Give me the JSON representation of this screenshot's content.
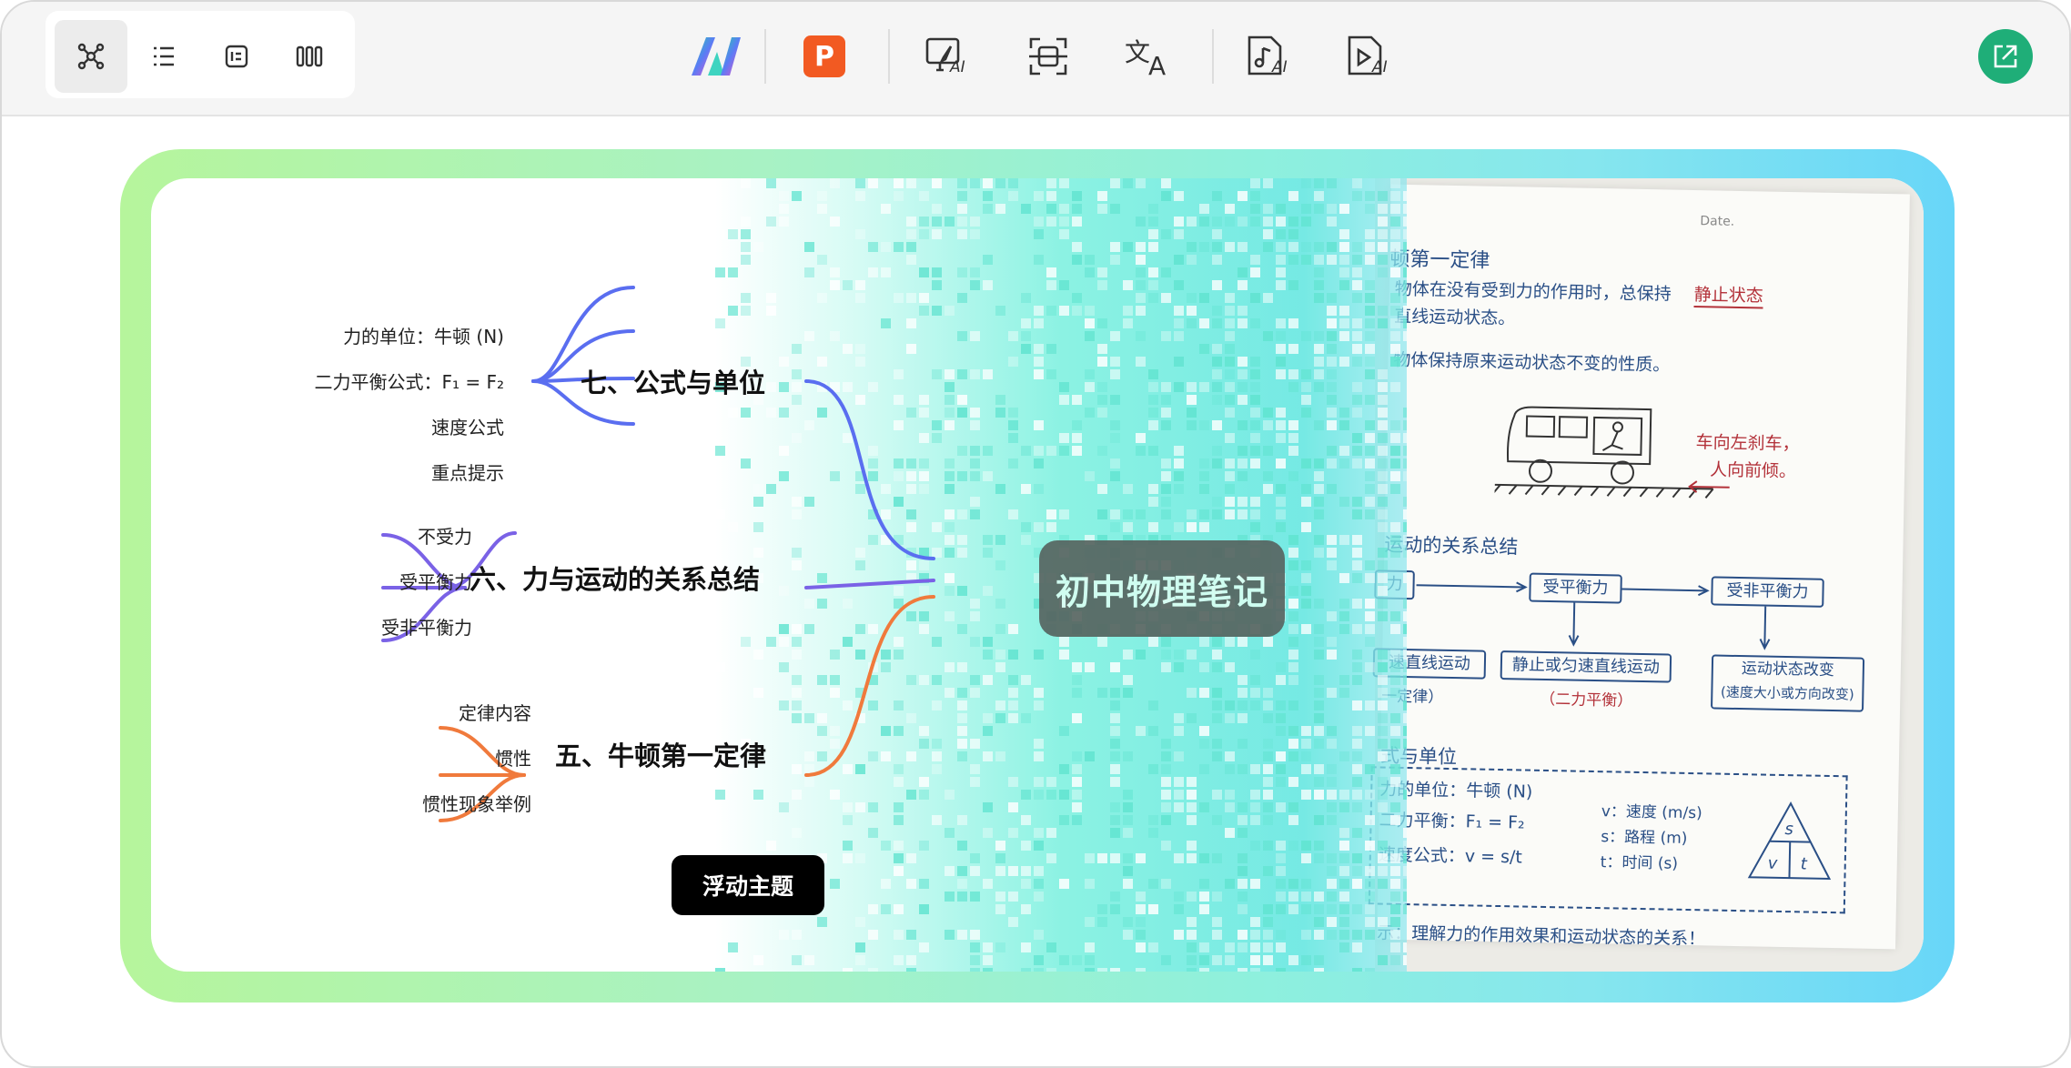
{
  "toolbar": {
    "view_buttons": [
      "mindmap-view",
      "outline-view",
      "card-view",
      "column-view"
    ],
    "tool_buttons": [
      "mindmap-logo",
      "ppt",
      "ai-edit",
      "ocr-scan",
      "translate",
      "ai-audio",
      "ai-video"
    ],
    "tool_labels": {
      "ppt": "P",
      "ai_edit": "AI",
      "ai_audio": "AI",
      "ai_video": "AI",
      "translate_zh": "文",
      "translate_en": "A"
    },
    "accent_share": "#1fae78",
    "accent_ppt": "#f25a22"
  },
  "mindmap": {
    "center": "初中物理笔记",
    "branches": [
      {
        "title": "七、公式与单位",
        "color": "#5a6ef0",
        "leaves": [
          "力的单位：牛顿 (N)",
          "二力平衡公式：F₁ = F₂",
          "速度公式",
          "重点提示"
        ]
      },
      {
        "title": "六、力与运动的关系总结",
        "color": "#7a62e6",
        "leaves": [
          "不受力",
          "受平衡力",
          "受非平衡力"
        ]
      },
      {
        "title": "五、牛顿第一定律",
        "color": "#f07a3c",
        "leaves": [
          "定律内容",
          "惯性",
          "惯性现象举例"
        ]
      }
    ],
    "floating_topic": "浮动主题"
  },
  "notes": {
    "date_label": "Date.",
    "law_title": "顿第一定律",
    "law_line1": "物体在没有受到力的作用时，总保持",
    "law_highlight": "静止状态",
    "law_line2": "直线运动状态。",
    "inertia_line": "物体保持原来运动状态不变的性质。",
    "bus_caption1": "车向左刹车，",
    "bus_caption2": "人向前倾。",
    "relation_title": "运动的关系总结",
    "box_left": "力",
    "box_mid": "受平衡力",
    "box_right": "受非平衡力",
    "result_left": "速直线运动",
    "result_left_sub": "一定律）",
    "result_mid": "静止或匀速直线运动",
    "result_mid_sub": "（二力平衡）",
    "result_right": "运动状态改变",
    "result_right_sub": "(速度大小或方向改变)",
    "formula_title": "式与单位",
    "formula_unit": "力的单位：牛顿 (N)",
    "formula_balance": "二力平衡：F₁ = F₂",
    "formula_speed": "速度公式：v = s/t",
    "var_v": "v：速度 (m/s)",
    "var_s": "s：路程 (m)",
    "var_t": "t：时间 (s)",
    "tri_s": "s",
    "tri_v": "v",
    "tri_t": "t",
    "tip": "示：理解力的作用效果和运动状态的关系！"
  }
}
